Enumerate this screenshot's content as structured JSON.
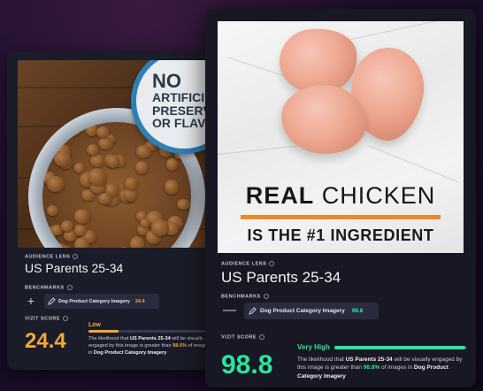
{
  "back_card": {
    "image": {
      "badge_line1": "NO",
      "badge_line2": "ARTIFICI",
      "badge_line3": "PRESERVATI",
      "badge_line4": "OR FLAVO",
      "icon": "dog-food-bowl-image"
    },
    "audience_lens_label": "AUDIENCE LENS",
    "audience_lens_value": "US Parents 25-34",
    "benchmarks_label": "BENCHMARKS",
    "add_symbol": "+",
    "benchmark_chip_label": "Dog Product Category Imagery",
    "benchmark_chip_score": "24.4",
    "score_label": "VIZIT SCORE",
    "score": "24.4",
    "level": "Low",
    "level_fraction": 0.244,
    "desc_prefix": "The likelihood that ",
    "desc_audience": "US Parents 25-34",
    "desc_mid": " will be visually engaged by this image is greater than ",
    "desc_pct": "98.6%",
    "desc_mid2": " of images in ",
    "desc_category": "Dog Product Category Imagery",
    "accent_color": "#f0a93a"
  },
  "front_card": {
    "image": {
      "headline_bold": "REAL",
      "headline_light": "CHICKEN",
      "subheadline": "IS THE #1 INGREDIENT",
      "icon": "raw-chicken-image"
    },
    "audience_lens_label": "AUDIENCE LENS",
    "audience_lens_value": "US Parents 25-34",
    "benchmarks_label": "BENCHMARKS",
    "remove_symbol": "—",
    "benchmark_chip_label": "Dog Product Category Imagery",
    "benchmark_chip_score": "98.8",
    "score_label": "VIZIT SCORE",
    "score": "98.8",
    "level": "Very High",
    "level_fraction": 0.988,
    "desc_prefix": "The likelihood that ",
    "desc_audience": "US Parents 25-34",
    "desc_mid": " will be visually engaged by this image is greater than ",
    "desc_pct": "98.8%",
    "desc_mid2": " of images in ",
    "desc_category": "Dog Product Category Imagery",
    "accent_color": "#2fe3a0"
  }
}
